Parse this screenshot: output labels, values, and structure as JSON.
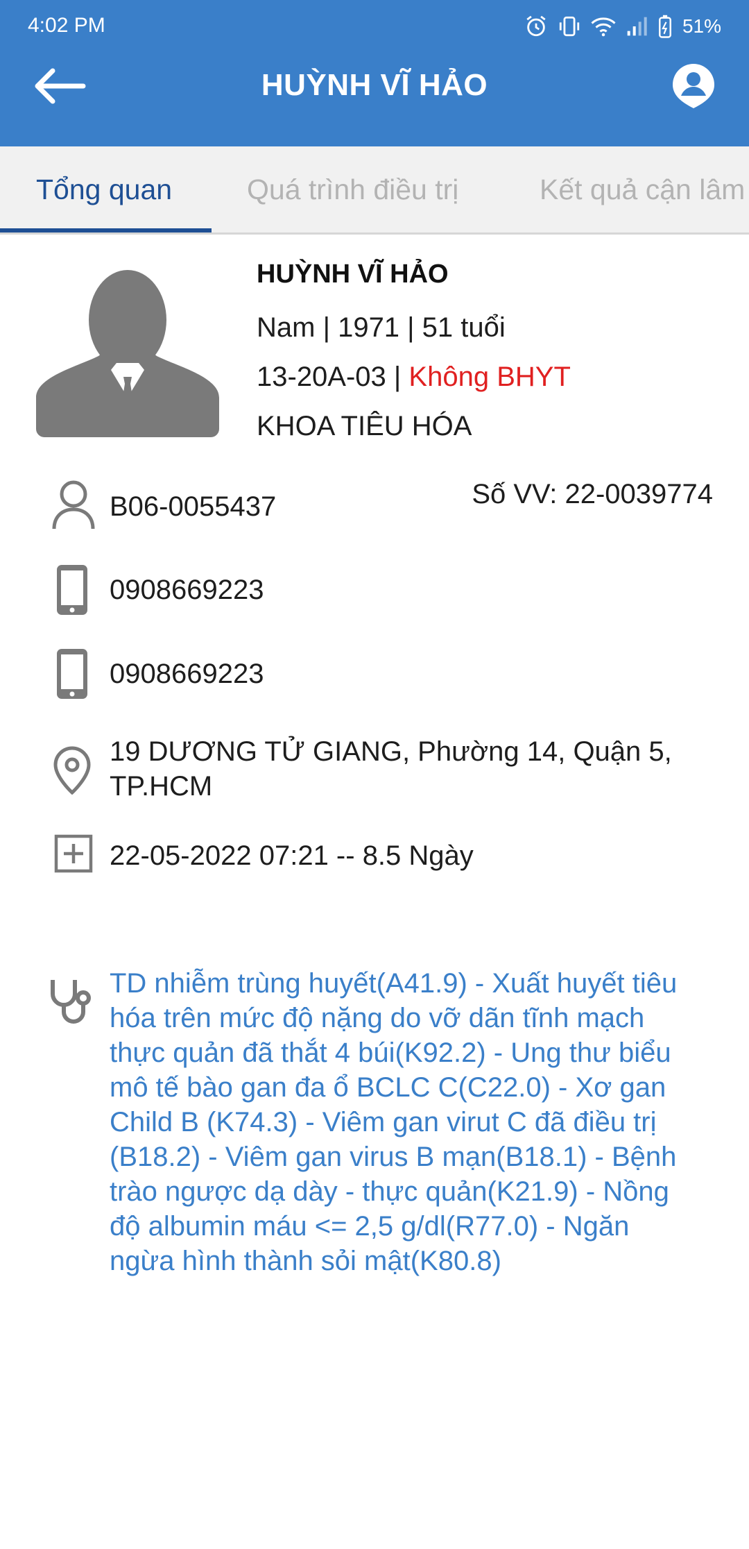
{
  "status_bar": {
    "time": "4:02 PM",
    "battery": "51%"
  },
  "header": {
    "title": "HUỲNH VĨ HẢO"
  },
  "tabs": [
    {
      "label": "Tổng quan",
      "active": true
    },
    {
      "label": "Quá trình điều trị",
      "active": false
    },
    {
      "label": "Kết quả cận lâm",
      "active": false
    }
  ],
  "patient": {
    "name": "HUỲNH VĨ HẢO",
    "demographics": "Nam | 1971 | 51 tuổi",
    "bed": "13-20A-03 | ",
    "insurance": "Không BHYT",
    "department": "KHOA TIÊU HÓA",
    "patient_id": "B06-0055437",
    "admission_no": "Số VV: 22-0039774",
    "phone_1": "0908669223",
    "phone_2": "0908669223",
    "address": "19 DƯƠNG TỬ GIANG, Phường 14, Quận 5, TP.HCM",
    "admission": "22-05-2022 07:21 -- 8.5 Ngày",
    "diagnosis": "TD nhiễm trùng huyết(A41.9) - Xuất huyết tiêu hóa trên mức độ nặng do vỡ dãn tĩnh mạch thực quản đã thắt 4 búi(K92.2) - Ung thư biểu mô tế bào gan đa ổ BCLC C(C22.0) - Xơ gan Child B (K74.3) - Viêm gan virut C đã điều trị  (B18.2) - Viêm gan virus B mạn(B18.1) - Bệnh trào ngược dạ dày - thực quản(K21.9) - Nồng độ albumin máu <= 2,5 g/dl(R77.0) - Ngăn ngừa hình thành sỏi mật(K80.8)"
  },
  "colors": {
    "primary": "#3a7fc9",
    "tab_active": "#1e4f94",
    "insurance_warning": "#e02020"
  }
}
